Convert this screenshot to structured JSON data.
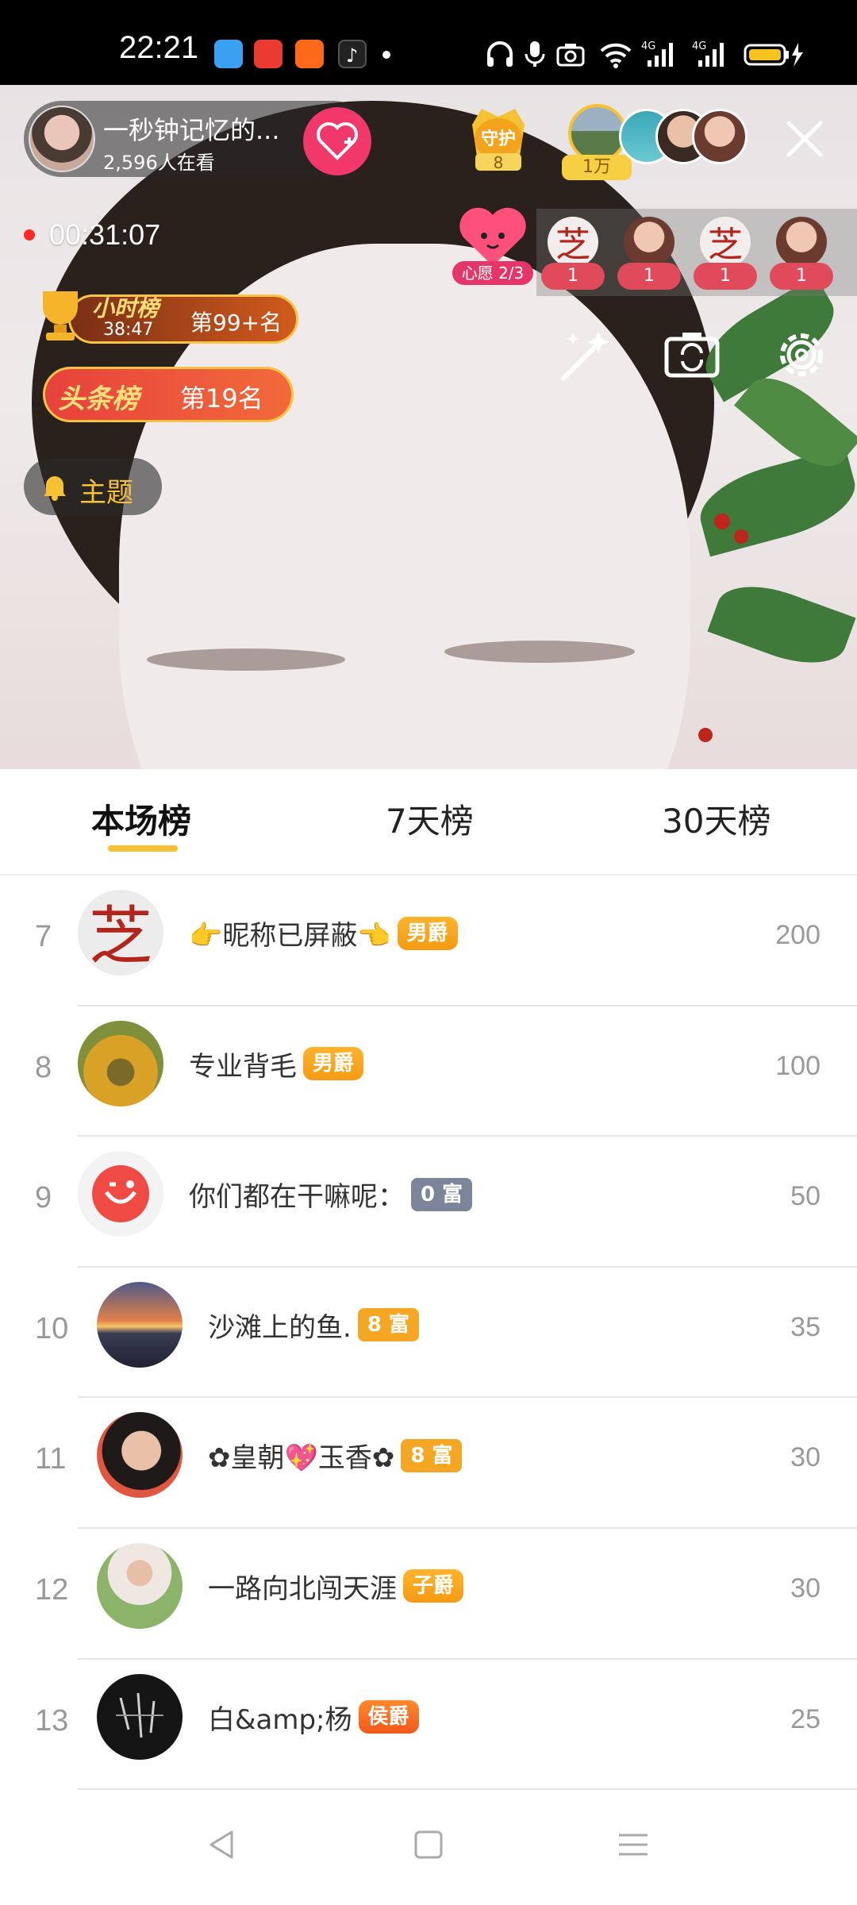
{
  "status_bar": {
    "time": "22:21"
  },
  "live": {
    "anchor_name": "一秒钟记忆的...",
    "viewers": "2,596人在看",
    "guard_label": "守护",
    "guard_count": "8",
    "tenk_label": "1万",
    "elapsed": "00:31:07",
    "wish_label": "心愿 2/3",
    "fan_counts": [
      "1",
      "1",
      "1",
      "1"
    ],
    "hour_rank_title": "小时榜",
    "hour_rank_timer": "38:47",
    "hour_rank_position": "第99+名",
    "headline_rank_title": "头条榜",
    "headline_rank_position": "第19名",
    "topic_label": "主题"
  },
  "tabs": [
    {
      "label": "本场榜",
      "active": true
    },
    {
      "label": "7天榜",
      "active": false
    },
    {
      "label": "30天榜",
      "active": false
    }
  ],
  "leaderboard": [
    {
      "rank": "7",
      "name": "👉昵称已屏蔽👈",
      "badge": "男爵",
      "badge_type": "nobility",
      "score": "200"
    },
    {
      "rank": "8",
      "name": "专业背毛",
      "badge": "男爵",
      "badge_type": "nobility",
      "score": "100"
    },
    {
      "rank": "9",
      "name": "你们都在干嘛呢：",
      "badge": "0 富",
      "badge_type": "rich-gray",
      "score": "50"
    },
    {
      "rank": "10",
      "name": "沙滩上的鱼.",
      "badge": "8 富",
      "badge_type": "rich",
      "score": "35"
    },
    {
      "rank": "11",
      "name": "✿皇朝💖玉香✿",
      "badge": "8 富",
      "badge_type": "rich",
      "score": "30"
    },
    {
      "rank": "12",
      "name": "一路向北闯天涯",
      "badge": "子爵",
      "badge_type": "nobility",
      "score": "30"
    },
    {
      "rank": "13",
      "name": "白&amp;杨",
      "badge": "侯爵",
      "badge_type": "nobility-orange",
      "score": "25"
    }
  ],
  "colors": {
    "accent": "#f6c132",
    "follow": "#f2386a",
    "rich_badge": "#f5a623",
    "rich_badge_zero": "#7b8498"
  }
}
